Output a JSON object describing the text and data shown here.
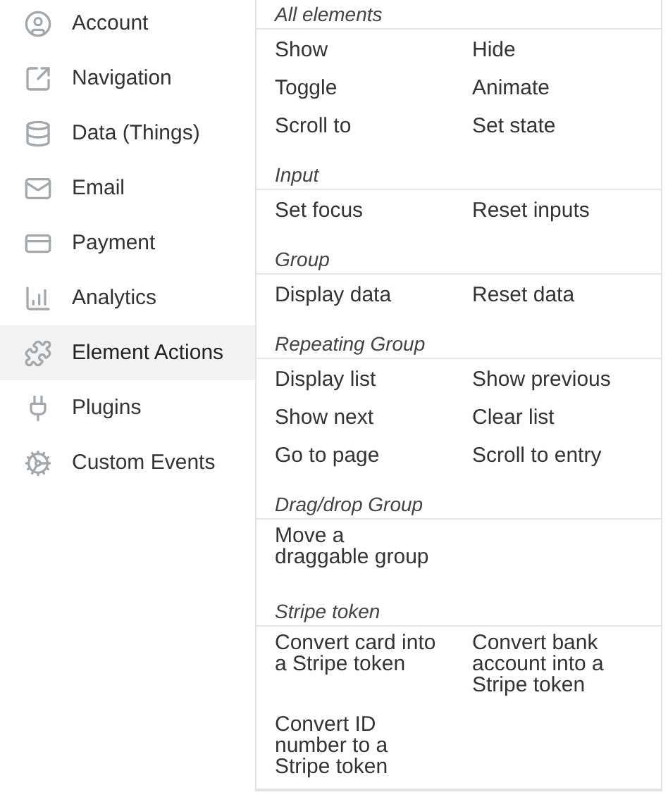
{
  "sidebar": {
    "items": [
      {
        "label": "Account",
        "selected": false
      },
      {
        "label": "Navigation",
        "selected": false
      },
      {
        "label": "Data (Things)",
        "selected": false
      },
      {
        "label": "Email",
        "selected": false
      },
      {
        "label": "Payment",
        "selected": false
      },
      {
        "label": "Analytics",
        "selected": false
      },
      {
        "label": "Element Actions",
        "selected": true
      },
      {
        "label": "Plugins",
        "selected": false
      },
      {
        "label": "Custom Events",
        "selected": false
      }
    ]
  },
  "actions": {
    "sections": [
      {
        "title": "All elements",
        "items": [
          "Show",
          "Hide",
          "Toggle",
          "Animate",
          "Scroll to",
          "Set state"
        ]
      },
      {
        "title": "Input",
        "items": [
          "Set focus",
          "Reset inputs"
        ]
      },
      {
        "title": "Group",
        "items": [
          "Display data",
          "Reset data"
        ]
      },
      {
        "title": "Repeating Group",
        "items": [
          "Display list",
          "Show previous",
          "Show next",
          "Clear list",
          "Go to page",
          "Scroll to entry"
        ]
      },
      {
        "title": "Drag/drop Group",
        "items": [
          "Move a\ndraggable group"
        ]
      },
      {
        "title": "Stripe token",
        "items": [
          "Convert card into\na Stripe token",
          "Convert bank\naccount into a\nStripe token",
          "Convert ID\nnumber to a\nStripe token"
        ]
      }
    ]
  }
}
